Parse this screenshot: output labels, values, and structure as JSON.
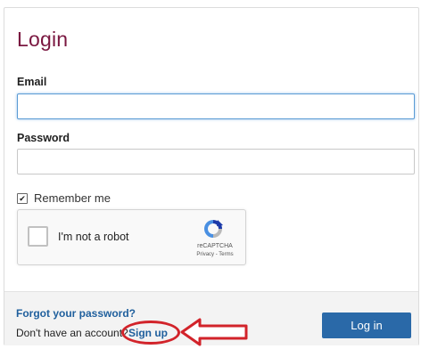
{
  "login": {
    "title": "Login",
    "email_label": "Email",
    "email_value": "",
    "password_label": "Password",
    "password_value": "",
    "remember_label": "Remember me",
    "remember_checked": true
  },
  "recaptcha": {
    "label": "I'm not a robot",
    "brand": "reCAPTCHA",
    "links": "Privacy - Terms"
  },
  "footer": {
    "forgot_link": "Forgot your password?",
    "no_account_text": "Don't have an account?",
    "signup_link": "Sign up",
    "login_button": "Log in"
  },
  "colors": {
    "title": "#7a1740",
    "link": "#1f5f9d",
    "button": "#2a69a8",
    "annotation": "#d2232a"
  },
  "icons": {
    "checkbox_checked": "checkmark-icon",
    "recaptcha_logo": "recaptcha-logo-icon",
    "annotation_arrow": "left-arrow-icon"
  }
}
